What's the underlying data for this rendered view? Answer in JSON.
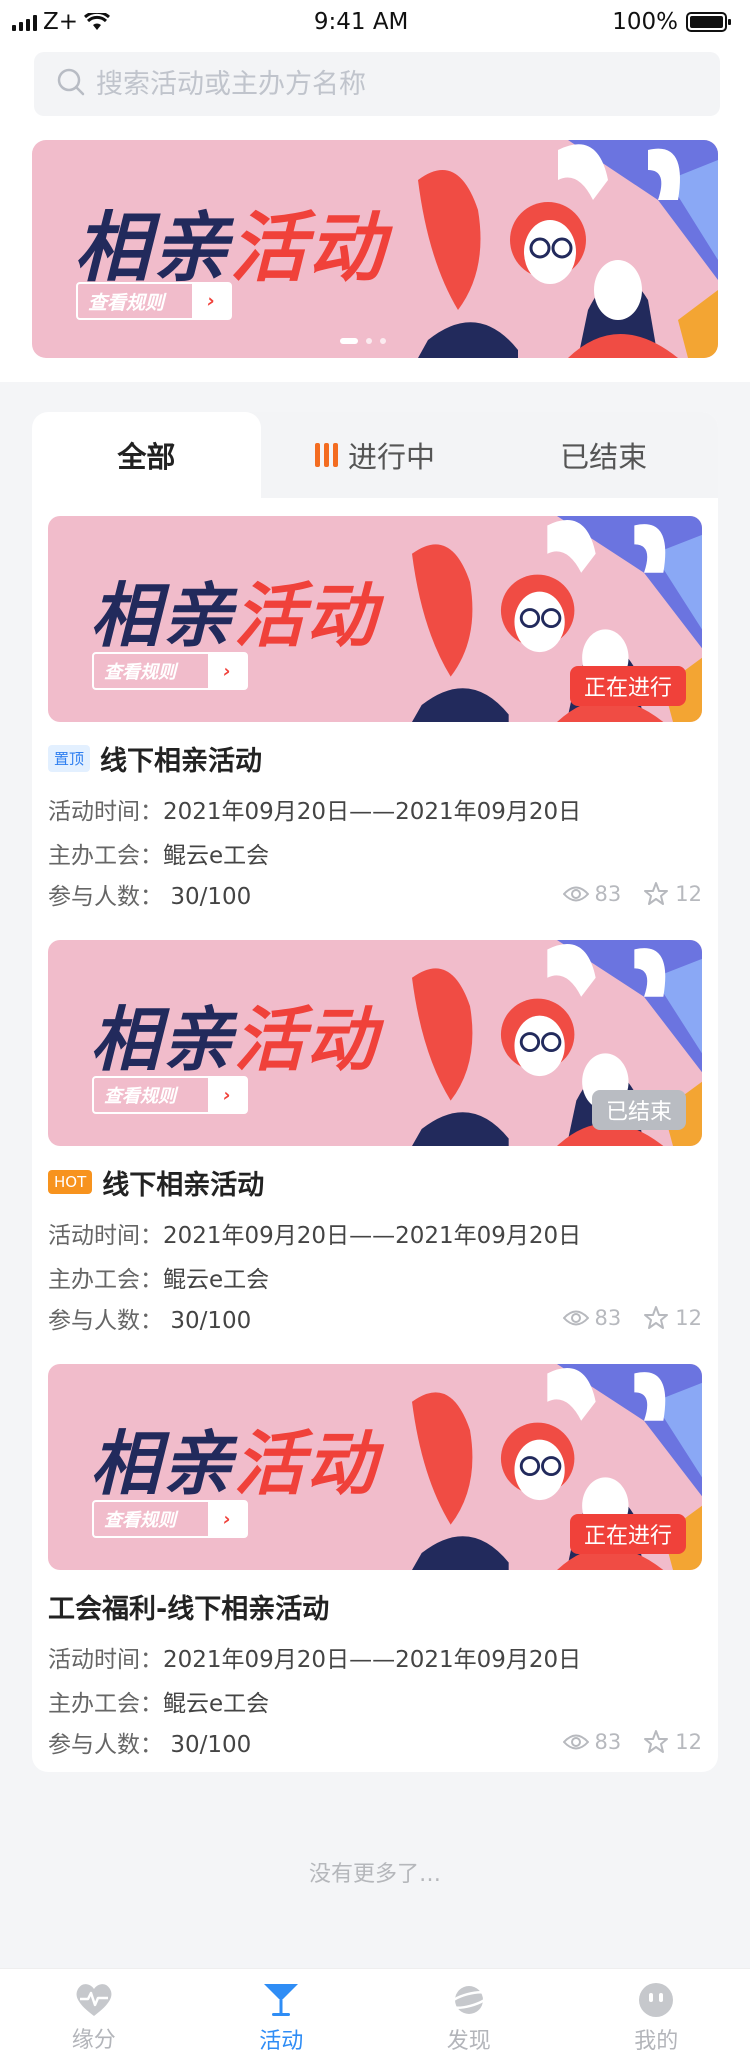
{
  "status_bar": {
    "carrier": "Z+",
    "time": "9:41 AM",
    "battery": "100%"
  },
  "search": {
    "placeholder": "搜索活动或主办方名称"
  },
  "banner": {
    "title_a": "相亲",
    "title_b": "活动",
    "rule_label": "查看规则",
    "dots_count": 3,
    "active_dot": 0
  },
  "tabs": [
    {
      "label": "全部",
      "active": true
    },
    {
      "label": "进行中",
      "active": false
    },
    {
      "label": "已结束",
      "active": false
    }
  ],
  "items": [
    {
      "badge": "置顶",
      "badge_type": "top",
      "title": "线下相亲活动",
      "status": "正在进行",
      "time_label": "活动时间：",
      "time_value": "2021年09月20日——2021年09月20日",
      "org_label": "主办工会：",
      "org_value": "鲲云e工会",
      "people_label": "参与人数：",
      "people_value": "30/100",
      "views": "83",
      "stars": "12"
    },
    {
      "badge": "HOT",
      "badge_type": "hot",
      "title": "线下相亲活动",
      "status": "已结束",
      "time_label": "活动时间：",
      "time_value": "2021年09月20日——2021年09月20日",
      "org_label": "主办工会：",
      "org_value": "鲲云e工会",
      "people_label": "参与人数：",
      "people_value": "30/100",
      "views": "83",
      "stars": "12"
    },
    {
      "badge": "",
      "badge_type": "",
      "title": "工会福利-线下相亲活动",
      "status": "正在进行",
      "time_label": "活动时间：",
      "time_value": "2021年09月20日——2021年09月20日",
      "org_label": "主办工会：",
      "org_value": "鲲云e工会",
      "people_label": "参与人数：",
      "people_value": "30/100",
      "views": "83",
      "stars": "12"
    }
  ],
  "footer": {
    "no_more": "没有更多了…"
  },
  "tabbar": [
    {
      "label": "缘分",
      "icon": "heart-pulse-icon",
      "active": false
    },
    {
      "label": "活动",
      "icon": "cocktail-icon",
      "active": true
    },
    {
      "label": "发现",
      "icon": "planet-icon",
      "active": false
    },
    {
      "label": "我的",
      "icon": "face-icon",
      "active": false
    }
  ],
  "colors": {
    "accent": "#2f8df5",
    "live": "#f0413a",
    "ended": "#b9bcc2",
    "banner_bg": "#f1bccb"
  }
}
